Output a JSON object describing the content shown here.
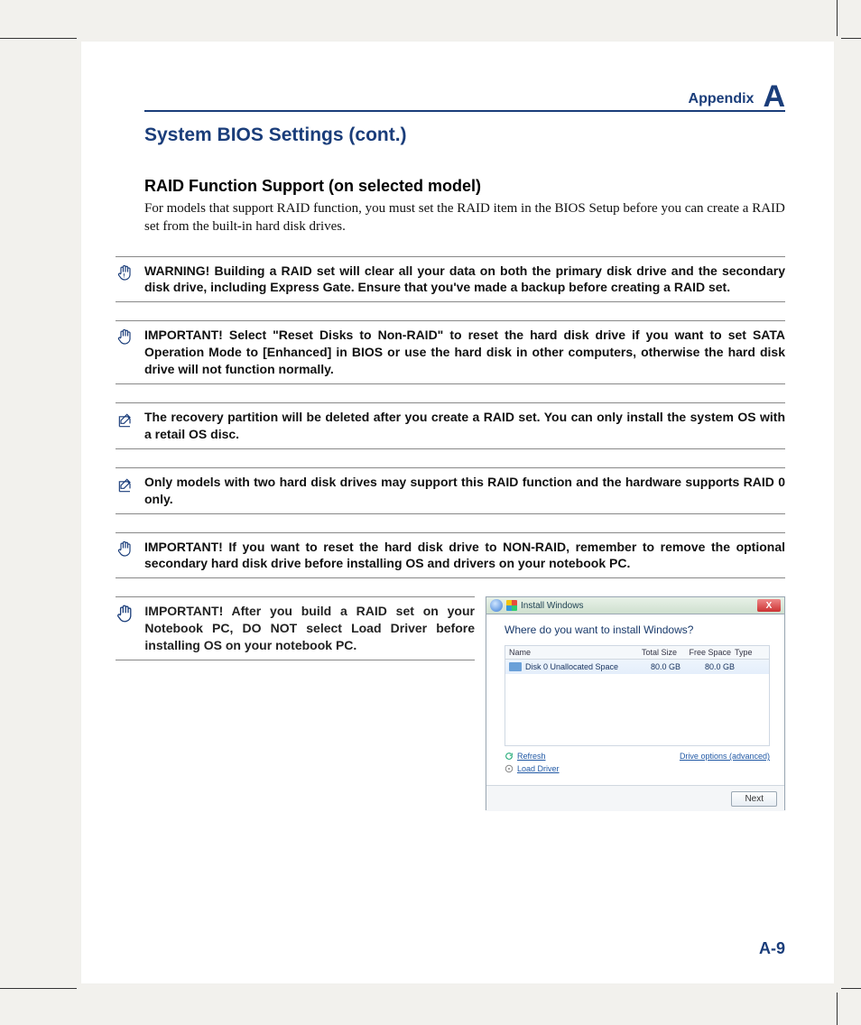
{
  "header": {
    "label": "Appendix",
    "letter": "A"
  },
  "title": "System BIOS Settings (cont.)",
  "section_heading": "RAID Function Support (on selected model)",
  "intro": "For models that support RAID function, you must set the RAID item in the BIOS Setup before you can create a RAID set from the built-in hard disk drives.",
  "callouts": [
    {
      "type": "warning",
      "text": "WARNING! Building a RAID set will clear all your data on both the primary disk drive and the secondary disk drive, including Express Gate. Ensure that you've made a backup before creating a RAID set."
    },
    {
      "type": "important",
      "text": "IMPORTANT! Select \"Reset Disks to Non-RAID\" to reset the hard disk drive if you want to set SATA Operation Mode to [Enhanced] in BIOS or use the hard disk in other computers, otherwise the hard disk drive will not function normally."
    },
    {
      "type": "note",
      "text": "The recovery partition will be deleted after you create a RAID set. You can only install the system OS with a retail OS disc."
    },
    {
      "type": "note",
      "text": "Only models with two hard disk drives may support this RAID function and the hardware supports RAID 0 only."
    },
    {
      "type": "important",
      "text": "IMPORTANT! If you want to reset the hard disk drive to NON-RAID, remember to remove the optional secondary hard disk drive before installing OS and drivers on your notebook PC."
    }
  ],
  "callout_with_image": {
    "type": "important",
    "text": "IMPORTANT! After you build a RAID set on your Notebook PC, DO NOT select Load Driver before installing OS on your notebook PC."
  },
  "installer": {
    "window_title": "Install Windows",
    "question": "Where do you want to install Windows?",
    "columns": {
      "name": "Name",
      "total": "Total Size",
      "free": "Free Space",
      "type": "Type"
    },
    "row": {
      "name": "Disk 0 Unallocated Space",
      "total": "80.0 GB",
      "free": "80.0 GB",
      "type": ""
    },
    "refresh": "Refresh",
    "load_driver": "Load Driver",
    "drive_options": "Drive options (advanced)",
    "next": "Next",
    "close_glyph": "X",
    "back_glyph": "←"
  },
  "page_number": "A-9"
}
